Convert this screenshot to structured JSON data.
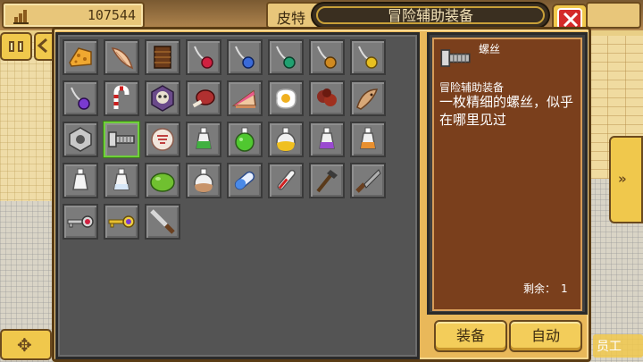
{
  "top_bar": {
    "money_value": "107544",
    "name_partial": "皮特",
    "title": "冒险辅助装备"
  },
  "detail": {
    "item_name": "螺丝",
    "category": "冒险辅助装备",
    "description": "一枚精细的螺丝，似乎在哪里见过",
    "count_label": "剩余：",
    "count_value": "1"
  },
  "buttons": {
    "equip": "装备",
    "auto": "自动"
  },
  "side": {
    "staff_label": "员工"
  },
  "inventory": {
    "rows": [
      [
        "sponge-icon",
        "shell-horn-icon",
        "wooden-crate-icon",
        "red-amulet-icon",
        "blue-amulet-icon",
        "green-amulet-icon",
        "amber-amulet-icon",
        "gold-amulet-icon"
      ],
      [
        "purple-amulet-icon",
        "candy-cane-icon",
        "skull-badge-icon",
        "meat-icon",
        "cake-slice-icon",
        "fried-egg-icon",
        "red-herb-icon",
        "dried-fish-icon"
      ],
      [
        "hex-nut-icon",
        "screw-icon",
        "coin-badge-icon",
        "green-potion-icon",
        "green-flask-icon",
        "yellow-flask-icon",
        "purple-potion-icon",
        "orange-potion-icon"
      ],
      [
        "empty-bottle-icon",
        "white-potion-icon",
        "green-slime-icon",
        "brown-potion-icon",
        "blue-capsule-icon",
        "thermometer-icon",
        "wood-brush-icon",
        "hand-saw-icon"
      ],
      [
        "red-key-icon",
        "gold-key-icon",
        "knife-icon"
      ]
    ],
    "selected": "screw-icon"
  }
}
